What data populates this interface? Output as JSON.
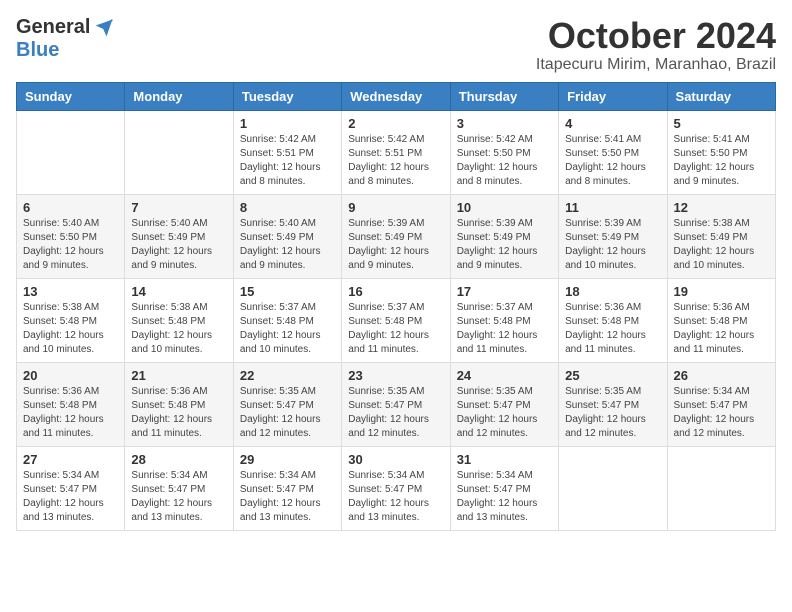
{
  "logo": {
    "general": "General",
    "blue": "Blue"
  },
  "title": "October 2024",
  "subtitle": "Itapecuru Mirim, Maranhao, Brazil",
  "days": [
    "Sunday",
    "Monday",
    "Tuesday",
    "Wednesday",
    "Thursday",
    "Friday",
    "Saturday"
  ],
  "weeks": [
    [
      {
        "date": "",
        "sunrise": "",
        "sunset": "",
        "daylight": ""
      },
      {
        "date": "",
        "sunrise": "",
        "sunset": "",
        "daylight": ""
      },
      {
        "date": "1",
        "sunrise": "Sunrise: 5:42 AM",
        "sunset": "Sunset: 5:51 PM",
        "daylight": "Daylight: 12 hours and 8 minutes."
      },
      {
        "date": "2",
        "sunrise": "Sunrise: 5:42 AM",
        "sunset": "Sunset: 5:51 PM",
        "daylight": "Daylight: 12 hours and 8 minutes."
      },
      {
        "date": "3",
        "sunrise": "Sunrise: 5:42 AM",
        "sunset": "Sunset: 5:50 PM",
        "daylight": "Daylight: 12 hours and 8 minutes."
      },
      {
        "date": "4",
        "sunrise": "Sunrise: 5:41 AM",
        "sunset": "Sunset: 5:50 PM",
        "daylight": "Daylight: 12 hours and 8 minutes."
      },
      {
        "date": "5",
        "sunrise": "Sunrise: 5:41 AM",
        "sunset": "Sunset: 5:50 PM",
        "daylight": "Daylight: 12 hours and 9 minutes."
      }
    ],
    [
      {
        "date": "6",
        "sunrise": "Sunrise: 5:40 AM",
        "sunset": "Sunset: 5:50 PM",
        "daylight": "Daylight: 12 hours and 9 minutes."
      },
      {
        "date": "7",
        "sunrise": "Sunrise: 5:40 AM",
        "sunset": "Sunset: 5:49 PM",
        "daylight": "Daylight: 12 hours and 9 minutes."
      },
      {
        "date": "8",
        "sunrise": "Sunrise: 5:40 AM",
        "sunset": "Sunset: 5:49 PM",
        "daylight": "Daylight: 12 hours and 9 minutes."
      },
      {
        "date": "9",
        "sunrise": "Sunrise: 5:39 AM",
        "sunset": "Sunset: 5:49 PM",
        "daylight": "Daylight: 12 hours and 9 minutes."
      },
      {
        "date": "10",
        "sunrise": "Sunrise: 5:39 AM",
        "sunset": "Sunset: 5:49 PM",
        "daylight": "Daylight: 12 hours and 9 minutes."
      },
      {
        "date": "11",
        "sunrise": "Sunrise: 5:39 AM",
        "sunset": "Sunset: 5:49 PM",
        "daylight": "Daylight: 12 hours and 10 minutes."
      },
      {
        "date": "12",
        "sunrise": "Sunrise: 5:38 AM",
        "sunset": "Sunset: 5:49 PM",
        "daylight": "Daylight: 12 hours and 10 minutes."
      }
    ],
    [
      {
        "date": "13",
        "sunrise": "Sunrise: 5:38 AM",
        "sunset": "Sunset: 5:48 PM",
        "daylight": "Daylight: 12 hours and 10 minutes."
      },
      {
        "date": "14",
        "sunrise": "Sunrise: 5:38 AM",
        "sunset": "Sunset: 5:48 PM",
        "daylight": "Daylight: 12 hours and 10 minutes."
      },
      {
        "date": "15",
        "sunrise": "Sunrise: 5:37 AM",
        "sunset": "Sunset: 5:48 PM",
        "daylight": "Daylight: 12 hours and 10 minutes."
      },
      {
        "date": "16",
        "sunrise": "Sunrise: 5:37 AM",
        "sunset": "Sunset: 5:48 PM",
        "daylight": "Daylight: 12 hours and 11 minutes."
      },
      {
        "date": "17",
        "sunrise": "Sunrise: 5:37 AM",
        "sunset": "Sunset: 5:48 PM",
        "daylight": "Daylight: 12 hours and 11 minutes."
      },
      {
        "date": "18",
        "sunrise": "Sunrise: 5:36 AM",
        "sunset": "Sunset: 5:48 PM",
        "daylight": "Daylight: 12 hours and 11 minutes."
      },
      {
        "date": "19",
        "sunrise": "Sunrise: 5:36 AM",
        "sunset": "Sunset: 5:48 PM",
        "daylight": "Daylight: 12 hours and 11 minutes."
      }
    ],
    [
      {
        "date": "20",
        "sunrise": "Sunrise: 5:36 AM",
        "sunset": "Sunset: 5:48 PM",
        "daylight": "Daylight: 12 hours and 11 minutes."
      },
      {
        "date": "21",
        "sunrise": "Sunrise: 5:36 AM",
        "sunset": "Sunset: 5:48 PM",
        "daylight": "Daylight: 12 hours and 11 minutes."
      },
      {
        "date": "22",
        "sunrise": "Sunrise: 5:35 AM",
        "sunset": "Sunset: 5:47 PM",
        "daylight": "Daylight: 12 hours and 12 minutes."
      },
      {
        "date": "23",
        "sunrise": "Sunrise: 5:35 AM",
        "sunset": "Sunset: 5:47 PM",
        "daylight": "Daylight: 12 hours and 12 minutes."
      },
      {
        "date": "24",
        "sunrise": "Sunrise: 5:35 AM",
        "sunset": "Sunset: 5:47 PM",
        "daylight": "Daylight: 12 hours and 12 minutes."
      },
      {
        "date": "25",
        "sunrise": "Sunrise: 5:35 AM",
        "sunset": "Sunset: 5:47 PM",
        "daylight": "Daylight: 12 hours and 12 minutes."
      },
      {
        "date": "26",
        "sunrise": "Sunrise: 5:34 AM",
        "sunset": "Sunset: 5:47 PM",
        "daylight": "Daylight: 12 hours and 12 minutes."
      }
    ],
    [
      {
        "date": "27",
        "sunrise": "Sunrise: 5:34 AM",
        "sunset": "Sunset: 5:47 PM",
        "daylight": "Daylight: 12 hours and 13 minutes."
      },
      {
        "date": "28",
        "sunrise": "Sunrise: 5:34 AM",
        "sunset": "Sunset: 5:47 PM",
        "daylight": "Daylight: 12 hours and 13 minutes."
      },
      {
        "date": "29",
        "sunrise": "Sunrise: 5:34 AM",
        "sunset": "Sunset: 5:47 PM",
        "daylight": "Daylight: 12 hours and 13 minutes."
      },
      {
        "date": "30",
        "sunrise": "Sunrise: 5:34 AM",
        "sunset": "Sunset: 5:47 PM",
        "daylight": "Daylight: 12 hours and 13 minutes."
      },
      {
        "date": "31",
        "sunrise": "Sunrise: 5:34 AM",
        "sunset": "Sunset: 5:47 PM",
        "daylight": "Daylight: 12 hours and 13 minutes."
      },
      {
        "date": "",
        "sunrise": "",
        "sunset": "",
        "daylight": ""
      },
      {
        "date": "",
        "sunrise": "",
        "sunset": "",
        "daylight": ""
      }
    ]
  ]
}
